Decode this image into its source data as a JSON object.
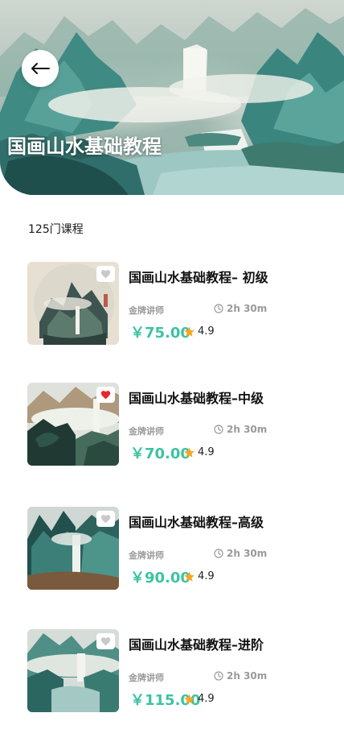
{
  "hero": {
    "title": "国画山水基础教程"
  },
  "count_label": "125门课程",
  "courses": [
    {
      "title": "国画山水基础教程– 初级",
      "teacher": "金牌讲师",
      "duration": "2h 30m",
      "price": "￥75.00",
      "rating": "4.9",
      "favorited": false
    },
    {
      "title": "国画山水基础教程–中级",
      "teacher": "金牌讲师",
      "duration": "2h 30m",
      "price": "￥70.00",
      "rating": "4.9",
      "favorited": true
    },
    {
      "title": "国画山水基础教程–高级",
      "teacher": "金牌讲师",
      "duration": "2h 30m",
      "price": "￥90.00",
      "rating": "4.9",
      "favorited": false
    },
    {
      "title": "国画山水基础教程–进阶",
      "teacher": "金牌讲师",
      "duration": "2h 30m",
      "price": "￥115.00",
      "rating": "4.9",
      "favorited": false
    }
  ],
  "icons": {
    "back": "arrow-left-icon",
    "favorite": "heart-icon",
    "clock": "clock-icon",
    "star": "star-icon"
  },
  "colors": {
    "accent": "#3cc3a2",
    "heart_active": "#e8262b",
    "heart_inactive": "#c9c9c9",
    "star": "#f5a623"
  }
}
